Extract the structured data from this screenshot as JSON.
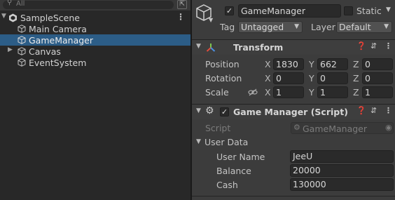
{
  "hierarchy": {
    "search_placeholder": "All",
    "scene_name": "SampleScene",
    "items": [
      {
        "label": "Main Camera"
      },
      {
        "label": "GameManager"
      },
      {
        "label": "Canvas"
      },
      {
        "label": "EventSystem"
      }
    ],
    "selected_item": "GameManager",
    "colors": {
      "selection": "#2c5d87",
      "panel": "#282828"
    }
  },
  "inspector": {
    "object_name": "GameManager",
    "active": true,
    "static_label": "Static",
    "tag_label": "Tag",
    "tag_value": "Untagged",
    "layer_label": "Layer",
    "layer_value": "Default",
    "transform": {
      "title": "Transform",
      "position_label": "Position",
      "rotation_label": "Rotation",
      "scale_label": "Scale",
      "position": {
        "x": "1830",
        "y": "662",
        "z": "0"
      },
      "rotation": {
        "x": "0",
        "y": "0",
        "z": "0"
      },
      "scale": {
        "x": "1",
        "y": "1",
        "z": "1"
      },
      "axis_labels": {
        "x": "X",
        "y": "Y",
        "z": "Z"
      }
    },
    "script_component": {
      "title": "Game Manager (Script)",
      "enabled": true,
      "script_label": "Script",
      "script_value": "GameManager",
      "group_label": "User Data",
      "user_name_label": "User Name",
      "user_name_value": "JeeU",
      "balance_label": "Balance",
      "balance_value": "20000",
      "cash_label": "Cash",
      "cash_value": "130000"
    },
    "colors": {
      "panel": "#3c3c3c",
      "field": "#2a2a2a"
    }
  }
}
